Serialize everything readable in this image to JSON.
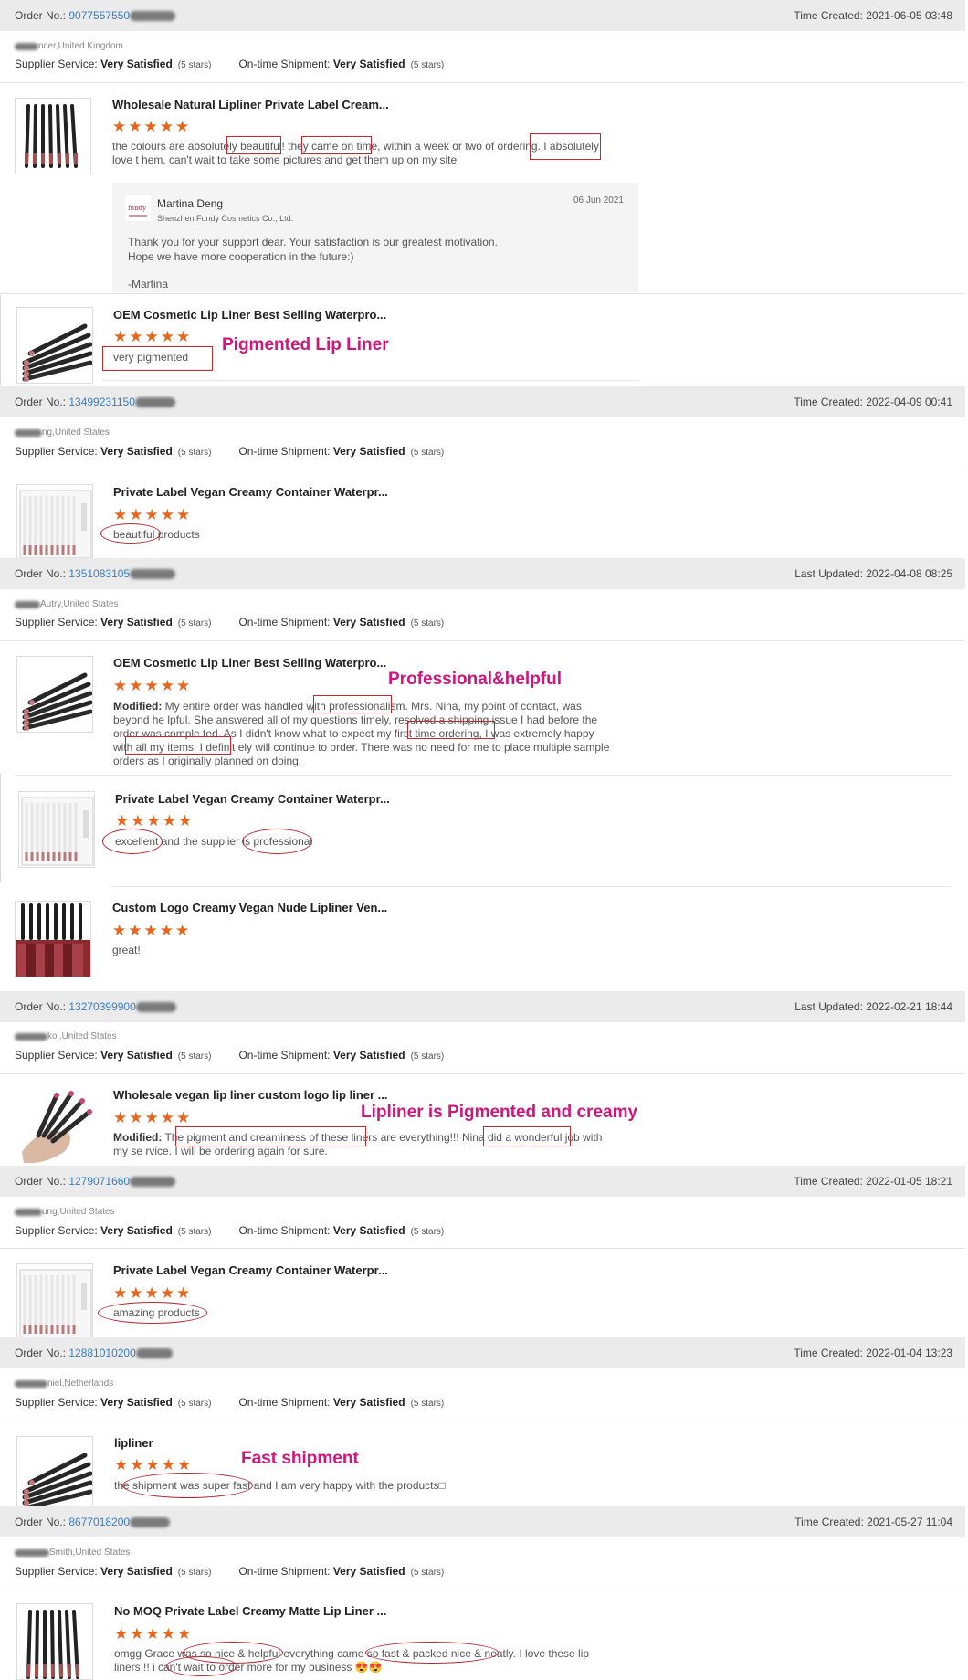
{
  "orders": [
    {
      "label": "Order No.:",
      "number": "9077557550",
      "time_label": "Time Created:",
      "time": "2021-06-05 03:48",
      "buyer": "ncer,United Kingdom"
    },
    {
      "label": "Order No.:",
      "number": "13499231150",
      "time_label": "Time Created:",
      "time": "2022-04-09 00:41",
      "buyer": "ng,United States"
    },
    {
      "label": "Order No.:",
      "number": "1351083105",
      "time_label": "Last Updated:",
      "time": "2022-04-08 08:25",
      "buyer": "Autry,United States"
    },
    {
      "label": "Order No.:",
      "number": "13270399900",
      "time_label": "Last Updated:",
      "time": "2022-02-21 18:44",
      "buyer": "koi,United States"
    },
    {
      "label": "Order No.:",
      "number": "1279071660",
      "time_label": "Time Created:",
      "time": "2022-01-05 18:21",
      "buyer": "ung,United States"
    },
    {
      "label": "Order No.:",
      "number": "12881010200",
      "time_label": "Time Created:",
      "time": "2022-01-04 13:23",
      "buyer": "niel,Netherlands"
    },
    {
      "label": "Order No.:",
      "number": "8677018200",
      "time_label": "Time Created:",
      "time": "2021-05-27 11:04",
      "buyer": "Smith,United States"
    }
  ],
  "service": {
    "supplier_label": "Supplier Service:",
    "ontime_label": "On-time Shipment:",
    "rating": "Very Satisfied",
    "stars": "(5 stars)"
  },
  "star_glyphs": "★★★★★",
  "reviews": [
    {
      "title": "Wholesale Natural Lipliner Private Label Cream...",
      "text": "the colours are absolutely beautiful! they came on time, within a week or two of ordering. I absolutely love t hem, can't wait to take some pictures and get them up on my site"
    },
    {
      "title": "OEM Cosmetic Lip Liner Best Selling Waterpro...",
      "text": "very pigmented"
    },
    {
      "title": "Private Label Vegan Creamy Container Waterpr...",
      "text": "beautiful products"
    },
    {
      "title": "OEM Cosmetic Lip Liner Best Selling Waterpro...",
      "modified": "Modified:",
      "text": "My entire order was handled with professionalism. Mrs. Nina, my point of contact, was beyond he lpful. She answered all of my questions timely, resolved a shipping issue I had before the order was comple ted. As I didn't know what to expect my first time ordering, I was extremely happy with all my items. I definit ely will continue to order. There was no need for me to place multiple sample orders as I originally planned on doing."
    },
    {
      "title": "Private Label Vegan Creamy Container Waterpr...",
      "text": "excellent and the supplier is professional"
    },
    {
      "title": "Custom Logo Creamy Vegan Nude Lipliner Ven...",
      "text": "great!"
    },
    {
      "title": "Wholesale vegan lip liner custom logo lip liner ...",
      "modified": "Modified:",
      "text": "The pigment and creaminess of these liners are everything!!! Nina did a wonderful job with my se rvice. I will be ordering again for sure."
    },
    {
      "title": "Private Label Vegan Creamy Container Waterpr...",
      "text": "amazing products"
    },
    {
      "title": "lipliner",
      "text": "the shipment was super fast and I am very happy with the products□"
    },
    {
      "title": "No MOQ Private Label Creamy Matte Lip Liner ...",
      "text": "omgg Grace was so nice & helpful everything came so fast & packed nice & neatly. I love these lip liners !! i can't wait to order more for my business 😍😍"
    }
  ],
  "reply": {
    "name": "Martina Deng",
    "company": "Shenzhen Fundy Cosmetics Co., Ltd.",
    "date": "06 Jun 2021",
    "line1": "Thank you for your support dear. Your satisfaction is our greatest motivation.",
    "line2": "Hope we have more cooperation in the future:)",
    "sign": "-Martina"
  },
  "annotations": {
    "a1": "Pigmented Lip Liner",
    "a2": "Professional&helpful",
    "a3": "Lipliner is Pigmented and creamy",
    "a4": "Fast shipment"
  },
  "colors": {
    "accent": "#e8661c",
    "annotation": "#d0167a",
    "highlight": "#c9252b",
    "link": "#3a7cbf"
  }
}
